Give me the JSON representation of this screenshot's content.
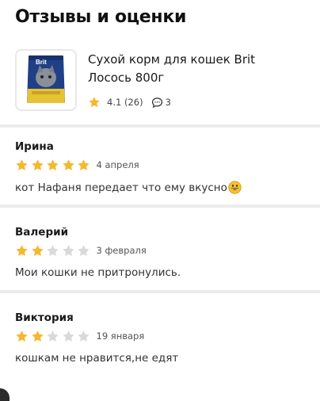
{
  "page": {
    "title": "Отзывы и оценки"
  },
  "product": {
    "name": "Сухой корм для кошек Brit Лосось 800г",
    "rating": "4.1 (26)",
    "comments_count": "3",
    "brand_on_pack": "Brit"
  },
  "reviews": [
    {
      "author": "Ирина",
      "stars": 5,
      "date": "4 апреля",
      "text": "кот Нафаня передает что ему вкусно",
      "emoji": "grinning-face"
    },
    {
      "author": "Валерий",
      "stars": 2,
      "date": "3 февраля",
      "text": "Мои кошки не притронулись."
    },
    {
      "author": "Виктория",
      "stars": 2,
      "date": "19 января",
      "text": "кошкам не нравится,не едят"
    }
  ],
  "colors": {
    "star_filled": "#f5b82e",
    "star_empty": "#d9d9d9",
    "divider": "#ececec"
  }
}
